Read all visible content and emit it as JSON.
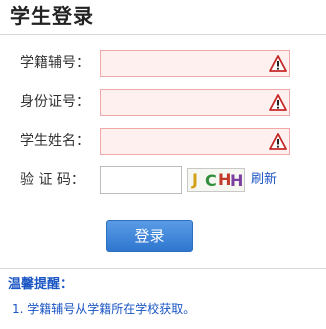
{
  "page": {
    "title": "学生登录"
  },
  "form": {
    "fields": [
      {
        "label": "学籍辅号：",
        "value": "",
        "status_icon": "warning-icon"
      },
      {
        "label": "身份证号：",
        "value": "",
        "status_icon": "warning-icon"
      },
      {
        "label": "学生姓名：",
        "value": "",
        "status_icon": "warning-icon"
      }
    ],
    "captcha": {
      "label": "验 证 码：",
      "value": "",
      "image_chars": [
        "J",
        "C",
        "H",
        "H"
      ],
      "image_colors": [
        "#d4a017",
        "#2f8f3a",
        "#c0392b",
        "#7b3fa0"
      ],
      "refresh_label": "刷新"
    },
    "submit_label": "登录"
  },
  "tips": {
    "title": "温馨提醒：",
    "items": [
      "1. 学籍辅号从学籍所在学校获取。"
    ]
  },
  "colors": {
    "invalid_border": "#f0a8a8",
    "invalid_background": "#fff0f0",
    "accent": "#1a55c4",
    "button": "#2e76cf",
    "warning": "#c62828"
  }
}
